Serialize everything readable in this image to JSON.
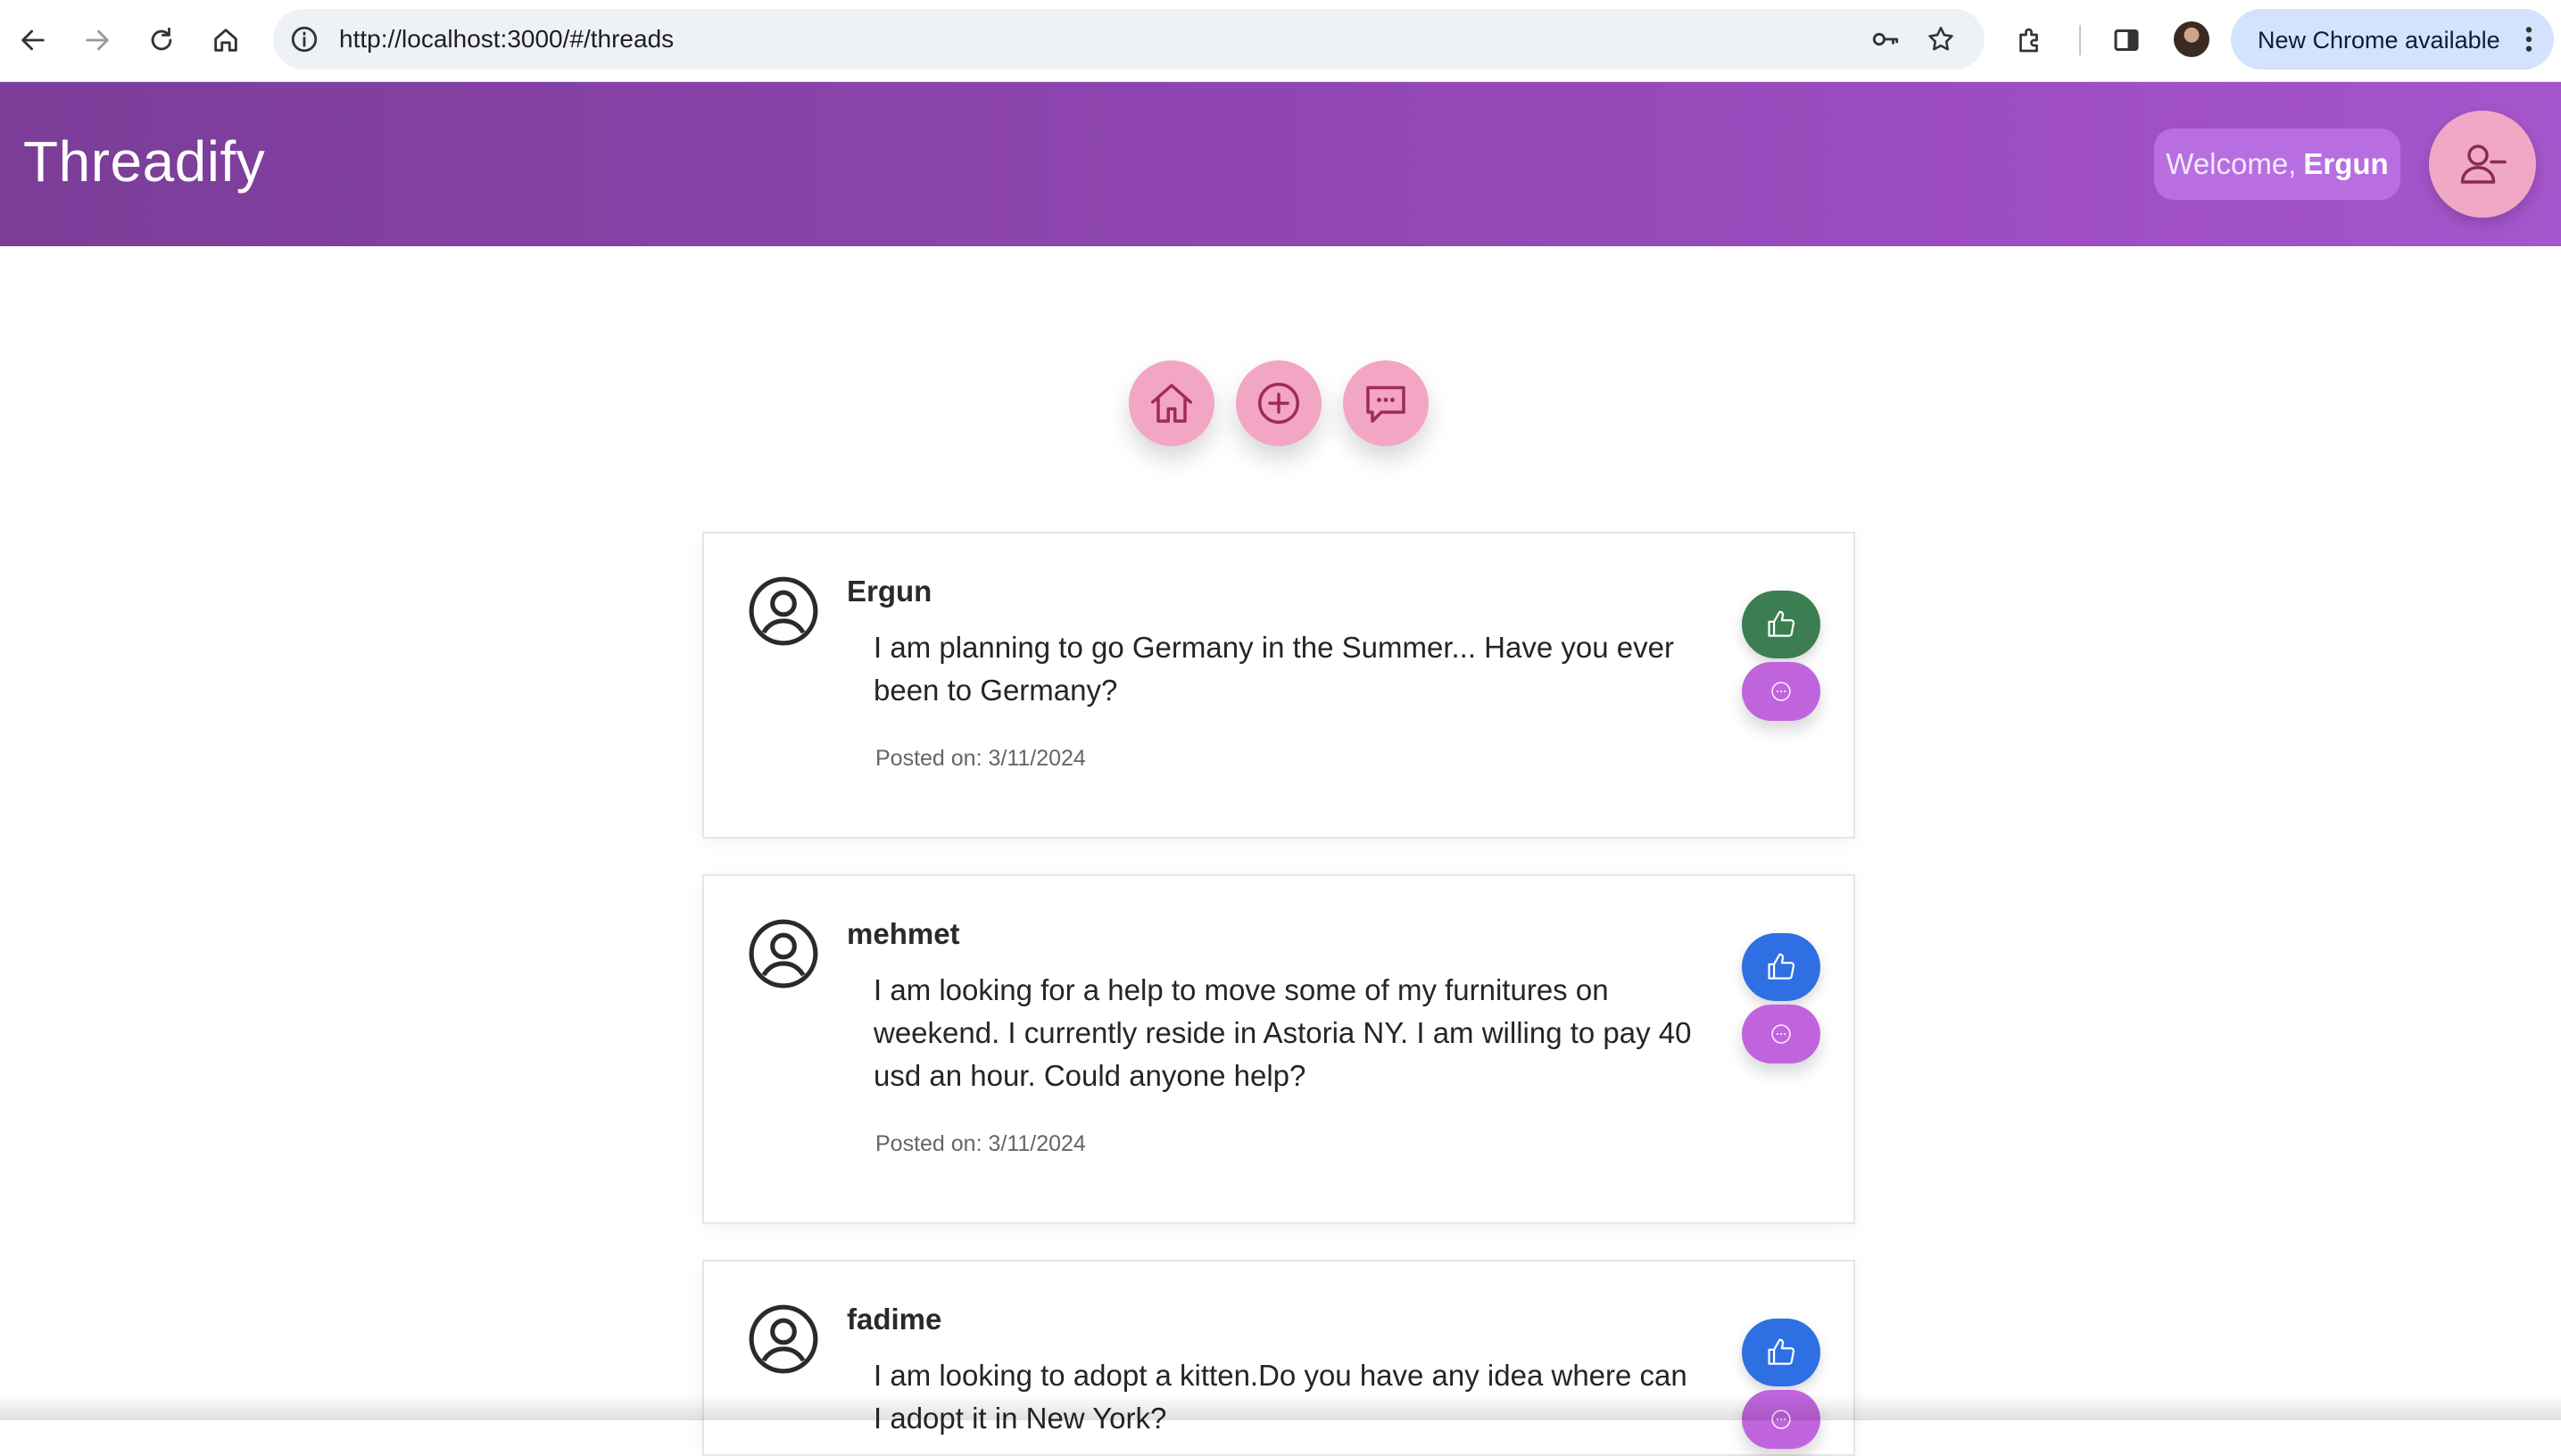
{
  "browser": {
    "url": "http://localhost:3000/#/threads",
    "update_label": "New Chrome available"
  },
  "app": {
    "brand": "Threadify",
    "welcome_prefix": "Welcome,",
    "welcome_user": "Ergun"
  },
  "nav": [
    {
      "icon": "home-icon"
    },
    {
      "icon": "plus-circle-icon"
    },
    {
      "icon": "chat-icon"
    }
  ],
  "threads": [
    {
      "author": "Ergun",
      "body": "I am planning to go Germany in the Summer... Have you ever been to Germany?",
      "posted": "Posted on: 3/11/2024",
      "liked": true,
      "like_color": "#3c7e52"
    },
    {
      "author": "mehmet",
      "body": "I am looking for a help to move some of my furnitures on weekend. I currently reside in Astoria NY. I am willing to pay 40 usd an hour. Could anyone help?",
      "posted": "Posted on: 3/11/2024",
      "liked": false,
      "like_color": "#2f6fe4"
    },
    {
      "author": "fadime",
      "body": "I am looking to adopt a kitten.Do you have any idea where can I adopt it in New York?",
      "posted": "",
      "liked": false,
      "like_color": "#2f6fe4"
    }
  ],
  "colors": {
    "header_gradient_start": "#7b3d98",
    "header_gradient_end": "#a656cc",
    "nav_circle": "#f2a6c4",
    "comment_button": "#c064de"
  }
}
